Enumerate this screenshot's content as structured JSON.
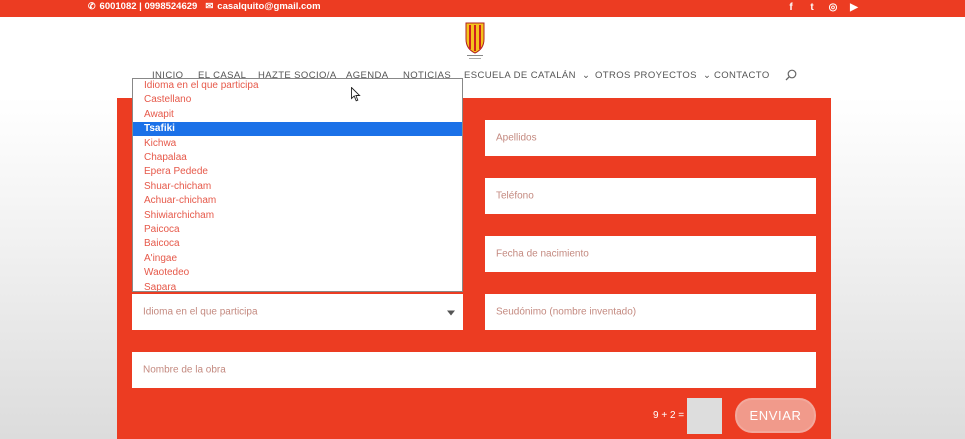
{
  "topbar": {
    "phone": "6001082 | 0998524629",
    "email": "casalquito@gmail.com",
    "social": [
      {
        "icon": "facebook-icon",
        "glyph": "f"
      },
      {
        "icon": "twitter-icon",
        "glyph": "t"
      },
      {
        "icon": "instagram-icon",
        "glyph": "◎"
      },
      {
        "icon": "youtube-icon",
        "glyph": "▶"
      }
    ]
  },
  "nav": {
    "items": [
      "INICIO",
      "EL CASAL",
      "HAZTE SOCIO/A",
      "AGENDA",
      "NOTICIAS",
      "ESCUELA DE CATALÁN",
      "OTROS PROYECTOS",
      "CONTACTO"
    ]
  },
  "form": {
    "apellidos_placeholder": "Apellidos",
    "telefono_placeholder": "Teléfono",
    "fecha_placeholder": "Fecha de nacimiento",
    "idioma_value": "Idioma en el que participa",
    "seudonimo_placeholder": "Seudónimo (nombre inventado)",
    "obra_placeholder": "Nombre de la obra",
    "captcha_label": "9 + 2 =",
    "submit_label": "ENVIAR"
  },
  "dropdown": {
    "options": [
      "Idioma en el que participa",
      "Castellano",
      "Awapit",
      "Tsafiki",
      "Kichwa",
      "Chapalaa",
      "Epera Pedede",
      "Shuar-chicham",
      "Achuar-chicham",
      "Shiwiarchicham",
      "Paicoca",
      "Baicoca",
      "A'ingae",
      "Waotedeo",
      "Sapara"
    ],
    "selected": "Tsafiki"
  },
  "colors": {
    "brand_red": "#ec3c22",
    "selected_blue": "#1b71e8"
  }
}
